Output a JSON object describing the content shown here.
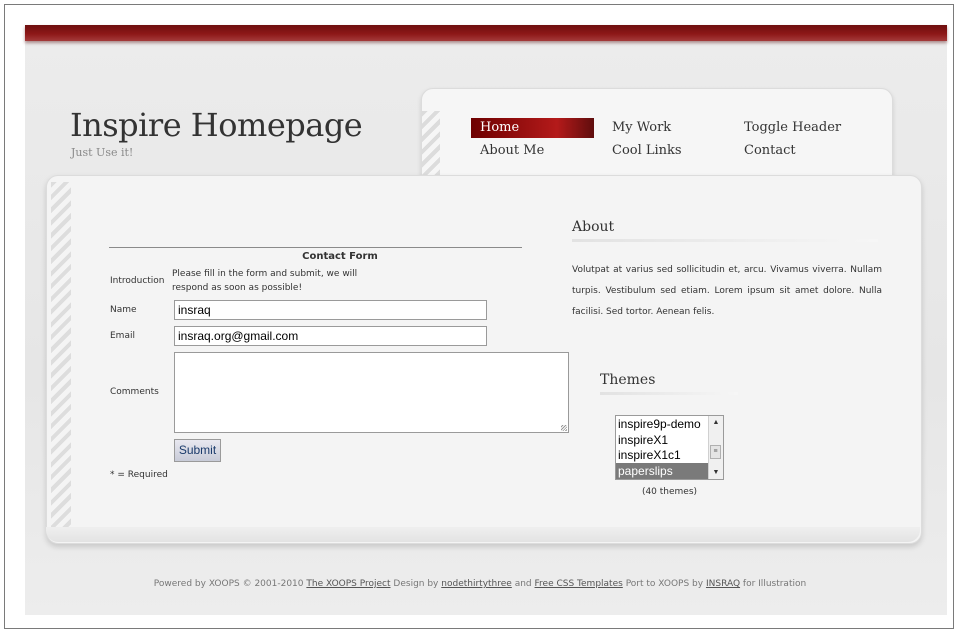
{
  "header": {
    "title": "Inspire Homepage",
    "tagline": "Just Use it!"
  },
  "nav": {
    "items": [
      {
        "label": "Home"
      },
      {
        "label": "My Work"
      },
      {
        "label": "Toggle Header"
      },
      {
        "label": "About Me"
      },
      {
        "label": "Cool Links"
      },
      {
        "label": "Contact"
      }
    ],
    "active": "Home"
  },
  "form": {
    "caption": "Contact Form",
    "intro_label": "Introduction",
    "intro_text": "Please fill in the form and submit, we will respond as soon as possible!",
    "name_label": "Name",
    "name_value": "insraq",
    "email_label": "Email",
    "email_value": "insraq.org@gmail.com",
    "comments_label": "Comments",
    "comments_value": "",
    "submit_label": "Submit",
    "required_note": "* = Required"
  },
  "about": {
    "title": "About",
    "text": "Volutpat at varius sed sollicitudin et, arcu. Vivamus viverra. Nullam turpis. Vestibulum sed etiam. Lorem ipsum sit amet dolore. Nulla facilisi. Sed tortor. Aenean felis."
  },
  "themes": {
    "title": "Themes",
    "options": [
      "inspire9p-demo",
      "inspireX1",
      "inspireX1c1",
      "paperslips"
    ],
    "selected": "paperslips",
    "count_text": "(40 themes)"
  },
  "footer": {
    "powered": "Powered by XOOPS © 2001-2010",
    "link_xoops": "The XOOPS Project",
    "design_by": "Design by",
    "link_designer": "nodethirtythree",
    "and": "and",
    "link_templates": "Free CSS Templates",
    "port_by": "Port to XOOPS by",
    "link_porter": "INSRAQ",
    "suffix": "for Illustration"
  },
  "colors": {
    "accent": "#8d1717",
    "background": "#ececec",
    "selected_option": "#7a7a7a"
  }
}
